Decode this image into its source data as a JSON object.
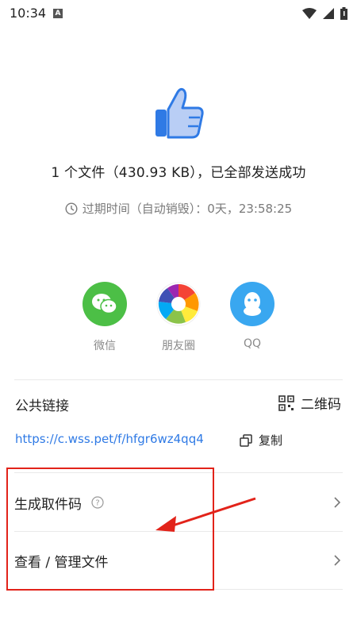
{
  "status_bar": {
    "time": "10:34",
    "app_icon_letter": "A"
  },
  "result": {
    "summary": "1 个文件（430.93 KB），已全部发送成功",
    "expiry": "过期时间（自动销毁）：0天，23:58:25"
  },
  "share_targets": [
    {
      "label": "微信",
      "color": "#4cbf46",
      "icon": "wechat-icon"
    },
    {
      "label": "朋友圈",
      "color": "#ffffff",
      "icon": "moments-icon"
    },
    {
      "label": "QQ",
      "color": "#39a7f0",
      "icon": "qq-icon"
    }
  ],
  "public_link": {
    "title": "公共链接",
    "qr_label": "二维码",
    "url": "https://c.wss.pet/f/hfgr6wz4qq4",
    "copy_label": "复制"
  },
  "actions": [
    {
      "label": "生成取件码",
      "has_help": true
    },
    {
      "label": "查看 / 管理文件",
      "has_help": false
    }
  ],
  "colors": {
    "accent_link": "#2f7ae5",
    "annotation_red": "#e2231a",
    "muted_text": "#7a7a7a"
  }
}
